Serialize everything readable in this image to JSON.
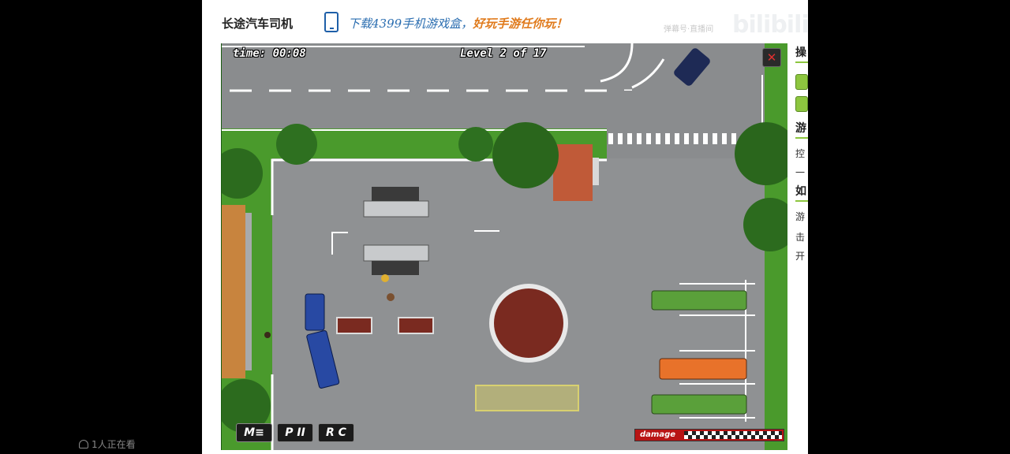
{
  "page": {
    "game_title": "长途汽车司机",
    "promo_text": "下载4399手机游戏盒，",
    "promo_highlight": "好玩手游任你玩！",
    "watermark_badge": "弹幕号·直播间",
    "watermark_logo": "bilibili"
  },
  "sidebar": {
    "heading_controls": "操",
    "heading_intro": "游",
    "line1": "控",
    "line2": "一",
    "heading_howto": "如",
    "line3": "游",
    "line4": "击",
    "line5": "开"
  },
  "hud": {
    "time": "time: 00:08",
    "level": "Level 2 of 17",
    "close_label": "✕"
  },
  "controls": {
    "menu_label": "M≡",
    "pause_label": "P II",
    "restart_label": "R C"
  },
  "damage": {
    "label": "damage",
    "level": 0
  },
  "footer": {
    "viewers": "1人正在看"
  },
  "colors": {
    "grass": "#4a9a2c",
    "asphalt": "#8a8c8e",
    "bus_blue": "#2849a3",
    "bus_green": "#5aa03a",
    "bus_orange": "#e8722a",
    "target_zone": "#c9c36a",
    "accent_blue": "#2a6db0",
    "accent_orange": "#e07b1d"
  }
}
